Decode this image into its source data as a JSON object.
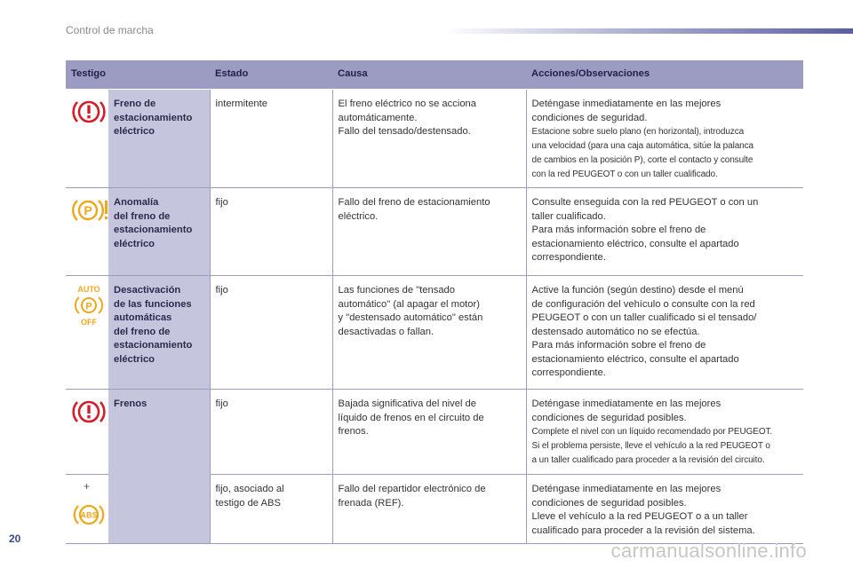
{
  "header": {
    "title": "Control de marcha"
  },
  "footer": {
    "page_number": "20",
    "watermark": "carmanualsonline.info"
  },
  "table": {
    "columns": [
      "Testigo",
      "Estado",
      "Causa",
      "Acciones/Observaciones"
    ],
    "rows": [
      {
        "icon": "brake-warning-icon",
        "name": [
          "Freno de",
          "estacionamiento",
          "eléctrico"
        ],
        "estado": [
          "intermitente"
        ],
        "causa": [
          "El freno eléctrico no se acciona",
          "automáticamente.",
          "Fallo del tensado/destensado."
        ],
        "acciones": [
          "Deténgase inmediatamente en las mejores",
          "condiciones de seguridad."
        ],
        "acciones_small": [
          "Estacione sobre suelo plano (en horizontal), introduzca",
          "una velocidad (para una caja automática, sitúe la palanca",
          "de cambios en la posición P), corte el contacto y consulte",
          "con la red PEUGEOT o con un taller cualificado."
        ]
      },
      {
        "icon": "parking-brake-fault-icon",
        "name": [
          "Anomalía",
          "del freno de",
          "estacionamiento",
          "eléctrico"
        ],
        "estado": [
          "fijo"
        ],
        "causa": [
          "Fallo del freno de estacionamiento",
          "eléctrico."
        ],
        "acciones": [
          "Consulte enseguida con la red PEUGEOT o con un",
          "taller cualificado.",
          "Para más información sobre el freno de",
          "estacionamiento eléctrico, consulte el apartado",
          "correspondiente."
        ]
      },
      {
        "icon": "auto-parking-off-icon",
        "icon_text_top": "AUTO",
        "icon_letter": "P",
        "icon_text_bottom": "OFF",
        "name": [
          "Desactivación",
          "de las funciones",
          "automáticas",
          "del freno de",
          "estacionamiento",
          "eléctrico"
        ],
        "estado": [
          "fijo"
        ],
        "causa": [
          "Las funciones de \"tensado",
          "automático\" (al apagar el motor)",
          "y \"destensado automático\" están",
          "desactivadas o fallan."
        ],
        "acciones": [
          "Active la función (según destino) desde el menú",
          "de configuración del vehículo o consulte con la red",
          "PEUGEOT o con un taller cualificado si el tensado/",
          "destensado automático no se efectúa.",
          "Para más información sobre el freno de",
          "estacionamiento eléctrico, consulte el apartado",
          "correspondiente."
        ]
      },
      {
        "icon": "brake-warning-icon",
        "name": [
          "Frenos"
        ],
        "estado": [
          "fijo"
        ],
        "causa": [
          "Bajada significativa del nivel de",
          "líquido de frenos en el circuito de",
          "frenos."
        ],
        "acciones": [
          "Deténgase inmediatamente en las mejores",
          "condiciones de seguridad posibles."
        ],
        "acciones_small": [
          "Complete el nivel con un líquido recomendado por PEUGEOT.",
          "Si el problema persiste, lleve el vehículo a la red PEUGEOT o",
          "a un taller cualificado para proceder a la revisión del circuito."
        ]
      },
      {
        "icon": "abs-icon",
        "icon_prefix": "+",
        "icon_letter": "ABS",
        "name": [],
        "estado": [
          "fijo, asociado al",
          "testigo de ABS"
        ],
        "causa": [
          "Fallo del repartidor electrónico de",
          "frenada (REF)."
        ],
        "acciones": [
          "Deténgase inmediatamente en las mejores",
          "condiciones de seguridad posibles.",
          "Lleve el vehículo a la red PEUGEOT o a un taller",
          "cualificado para proceder a la revisión del sistema."
        ]
      }
    ]
  },
  "colors": {
    "header_bg": "#9c9cc2",
    "name_bg": "#c5c6de",
    "icon_red": "#d21e2b",
    "icon_amber": "#f0a71a"
  }
}
